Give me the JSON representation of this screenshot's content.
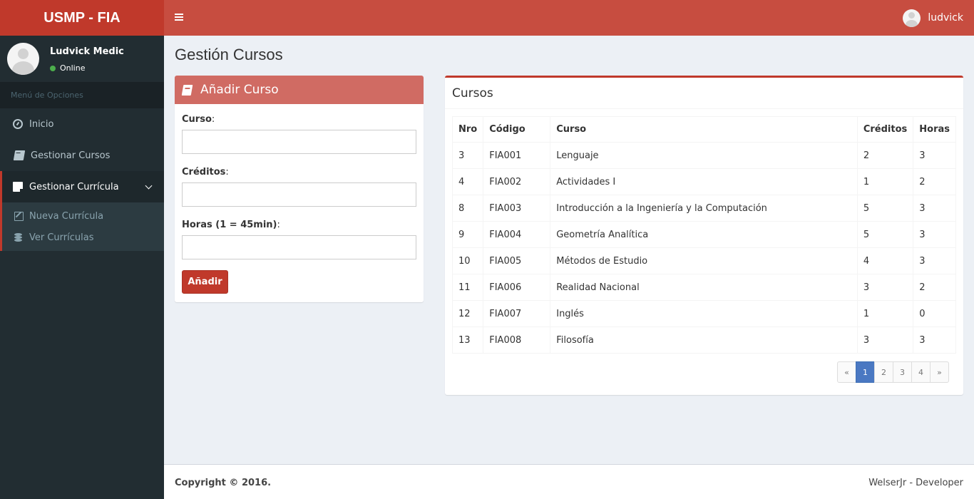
{
  "header": {
    "brand": "USMP - FIA",
    "user_name": "ludvick"
  },
  "sidebar": {
    "user": {
      "name": "Ludvick Medic",
      "status": "Online"
    },
    "menu_header": "Menú de Opciones",
    "items": [
      {
        "label": "Inicio",
        "icon": "dashboard-icon"
      },
      {
        "label": "Gestionar Cursos",
        "icon": "book-icon"
      },
      {
        "label": "Gestionar Currícula",
        "icon": "note-icon"
      }
    ],
    "subitems": [
      {
        "label": "Nueva Currícula",
        "icon": "edit-icon"
      },
      {
        "label": "Ver Currículas",
        "icon": "database-icon"
      }
    ]
  },
  "page": {
    "title": "Gestión Cursos"
  },
  "add_form": {
    "title": "Añadir Curso",
    "fields": [
      {
        "label": "Curso",
        "value": ""
      },
      {
        "label": "Créditos",
        "value": ""
      },
      {
        "label": "Horas (1 = 45min)",
        "value": ""
      }
    ],
    "submit_label": "Añadir"
  },
  "courses": {
    "title": "Cursos",
    "columns": [
      "Nro",
      "Código",
      "Curso",
      "Créditos",
      "Horas"
    ],
    "rows": [
      [
        "3",
        "FIA001",
        "Lenguaje",
        "2",
        "3"
      ],
      [
        "4",
        "FIA002",
        "Actividades I",
        "1",
        "2"
      ],
      [
        "8",
        "FIA003",
        "Introducción a la Ingeniería y la Computación",
        "5",
        "3"
      ],
      [
        "9",
        "FIA004",
        "Geometría Analítica",
        "5",
        "3"
      ],
      [
        "10",
        "FIA005",
        "Métodos de Estudio",
        "4",
        "3"
      ],
      [
        "11",
        "FIA006",
        "Realidad Nacional",
        "3",
        "2"
      ],
      [
        "12",
        "FIA007",
        "Inglés",
        "1",
        "0"
      ],
      [
        "13",
        "FIA008",
        "Filosofía",
        "3",
        "3"
      ]
    ],
    "pagination": {
      "prev": "«",
      "pages": [
        "1",
        "2",
        "3",
        "4"
      ],
      "next": "»",
      "current": "1"
    }
  },
  "footer": {
    "copyright": "Copyright © 2016.",
    "credit": "WelserJr - Developer"
  },
  "colors": {
    "accent": "#c0392b",
    "header": "#c74d40",
    "sidebar": "#222d32",
    "pagination_active": "#4a78c2"
  }
}
